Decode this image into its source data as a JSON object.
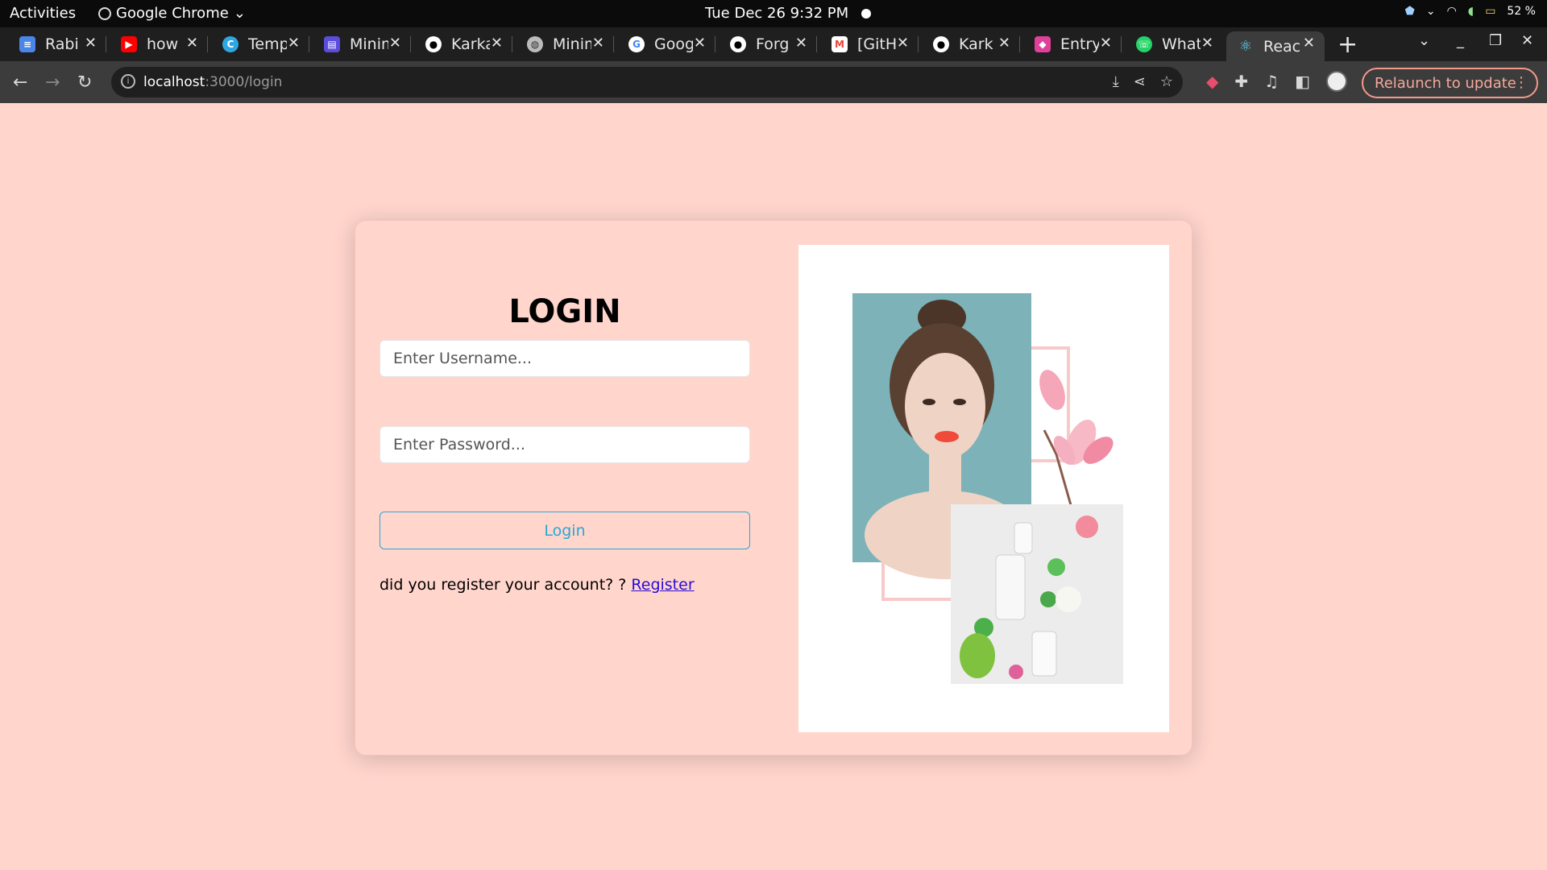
{
  "os": {
    "activities": "Activities",
    "app_name": "Google Chrome",
    "datetime": "Tue Dec 26   9:32 PM",
    "battery": "52 %"
  },
  "tabs": [
    {
      "label": "Rabi",
      "icon": "docs-icon",
      "color": "#4a86e8"
    },
    {
      "label": "how",
      "icon": "youtube-icon",
      "color": "#ff0000"
    },
    {
      "label": "Temp",
      "icon": "canva-icon",
      "color": "#2ea7e0"
    },
    {
      "label": "Minim",
      "icon": "minimal-icon",
      "color": "#5b4cdb"
    },
    {
      "label": "Karka",
      "icon": "github-icon",
      "color": "#ffffff"
    },
    {
      "label": "Minim",
      "icon": "globe-icon",
      "color": "#bbbbbb"
    },
    {
      "label": "Goog",
      "icon": "google-icon",
      "color": "#ffffff"
    },
    {
      "label": "Forg",
      "icon": "github-icon",
      "color": "#ffffff"
    },
    {
      "label": "[GitH",
      "icon": "gmail-icon",
      "color": "#ea4335"
    },
    {
      "label": "Kark",
      "icon": "github-icon",
      "color": "#ffffff"
    },
    {
      "label": "Entry",
      "icon": "cube-icon",
      "color": "#e0409a"
    },
    {
      "label": "What",
      "icon": "whatsapp-icon",
      "color": "#25d366"
    },
    {
      "label": "Reac",
      "icon": "react-icon",
      "color": "#61dafb",
      "active": true
    }
  ],
  "browser": {
    "url_host": "localhost",
    "url_path": ":3000/login",
    "relaunch_label": "Relaunch to update"
  },
  "login": {
    "title": "LOGIN",
    "username_placeholder": "Enter Username...",
    "password_placeholder": "Enter Password...",
    "button_label": "Login",
    "register_prompt": "did you register your account? ? ",
    "register_link": "Register"
  },
  "colors": {
    "page_bg": "#ffd5cc",
    "accent": "#29a8d6",
    "link": "#2a0cd8"
  }
}
